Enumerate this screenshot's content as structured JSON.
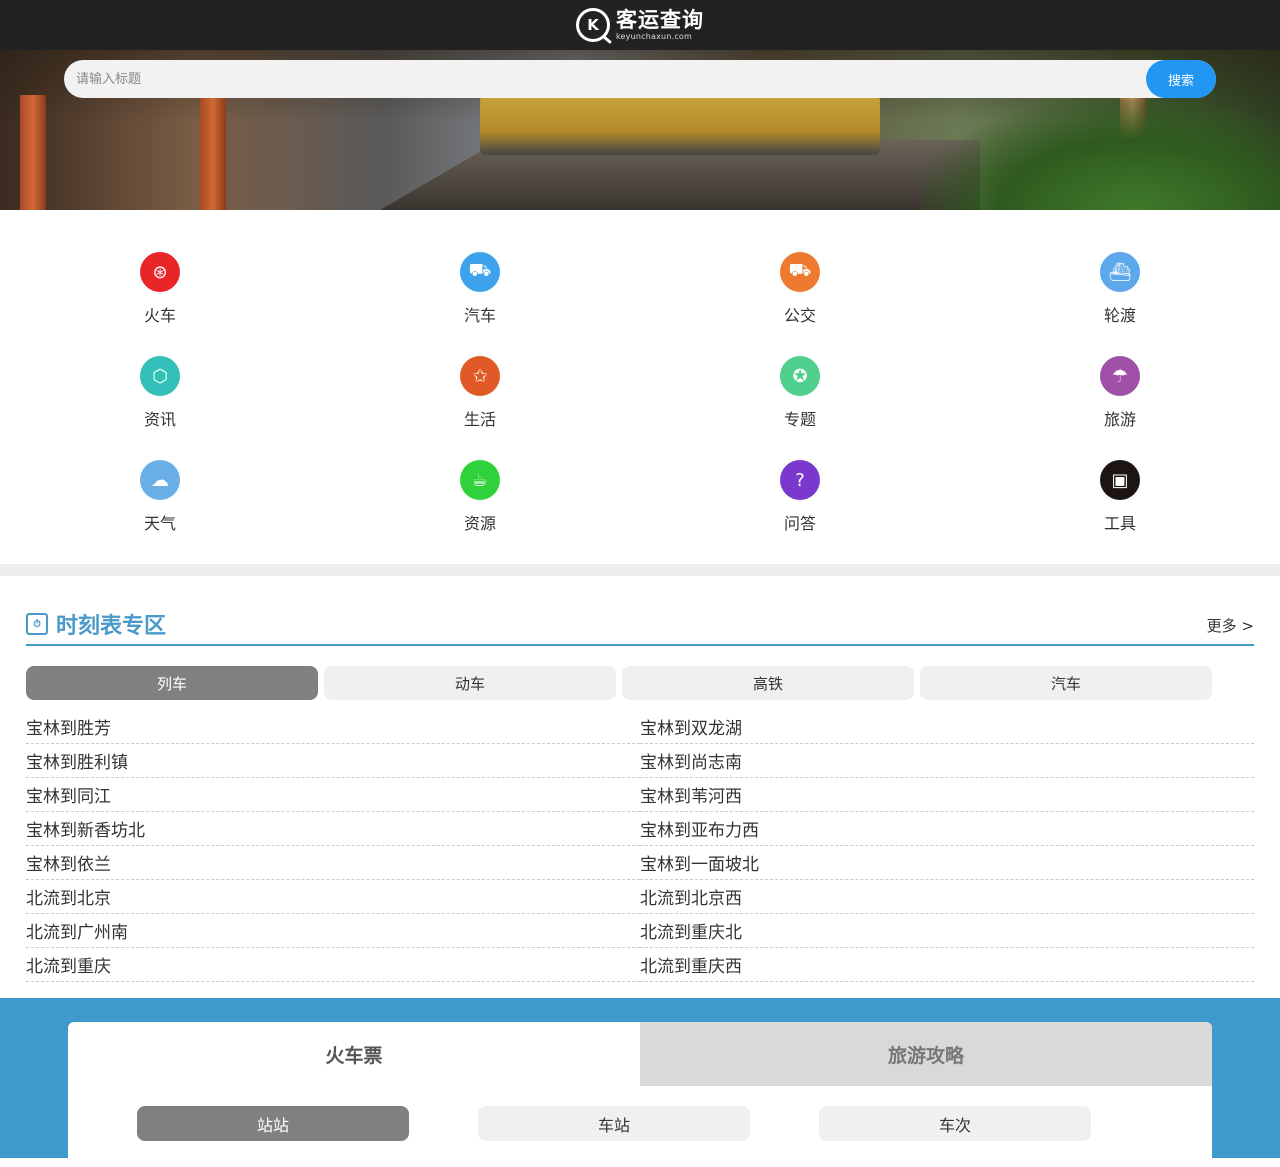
{
  "header": {
    "logo_cn": "客运查询",
    "logo_en": "keyunchaxun.com",
    "logo_mark": "K"
  },
  "search": {
    "placeholder": "请输入标题",
    "button": "搜索"
  },
  "categories": [
    {
      "label": "火车",
      "icon": "train-icon",
      "color": "#e8262a",
      "glyph": "⊛"
    },
    {
      "label": "汽车",
      "icon": "car-icon",
      "color": "#3ea3ec",
      "glyph": "⛟"
    },
    {
      "label": "公交",
      "icon": "bus-icon",
      "color": "#ee7a2f",
      "glyph": "⛟"
    },
    {
      "label": "轮渡",
      "icon": "ferry-icon",
      "color": "#5ca8ea",
      "glyph": "⛴"
    },
    {
      "label": "资讯",
      "icon": "news-icon",
      "color": "#32c0b8",
      "glyph": "⬡"
    },
    {
      "label": "生活",
      "icon": "life-icon",
      "color": "#e05a25",
      "glyph": "✩"
    },
    {
      "label": "专题",
      "icon": "topic-icon",
      "color": "#4fcf8e",
      "glyph": "✪"
    },
    {
      "label": "旅游",
      "icon": "travel-icon",
      "color": "#a150a8",
      "glyph": "☂"
    },
    {
      "label": "天气",
      "icon": "weather-icon",
      "color": "#6aaee8",
      "glyph": "☁"
    },
    {
      "label": "资源",
      "icon": "resource-icon",
      "color": "#2fd23a",
      "glyph": "☕"
    },
    {
      "label": "问答",
      "icon": "qa-icon",
      "color": "#7b38cf",
      "glyph": "?"
    },
    {
      "label": "工具",
      "icon": "tool-icon",
      "color": "#1d1414",
      "glyph": "▣"
    }
  ],
  "timetable": {
    "title": "时刻表专区",
    "more": "更多 >",
    "tabs": [
      "列车",
      "动车",
      "高铁",
      "汽车"
    ],
    "active_tab": 0,
    "items": [
      "宝林到胜芳",
      "宝林到双龙湖",
      "宝林到胜利镇",
      "宝林到尚志南",
      "宝林到同江",
      "宝林到苇河西",
      "宝林到新香坊北",
      "宝林到亚布力西",
      "宝林到依兰",
      "宝林到一面坡北",
      "北流到北京",
      "北流到北京西",
      "北流到广州南",
      "北流到重庆北",
      "北流到重庆",
      "北流到重庆西"
    ]
  },
  "panel": {
    "tabs": [
      "火车票",
      "旅游攻略"
    ],
    "active_tab": 0,
    "sub_tabs": [
      "站站",
      "车站",
      "车次"
    ],
    "active_sub_tab": 0
  }
}
